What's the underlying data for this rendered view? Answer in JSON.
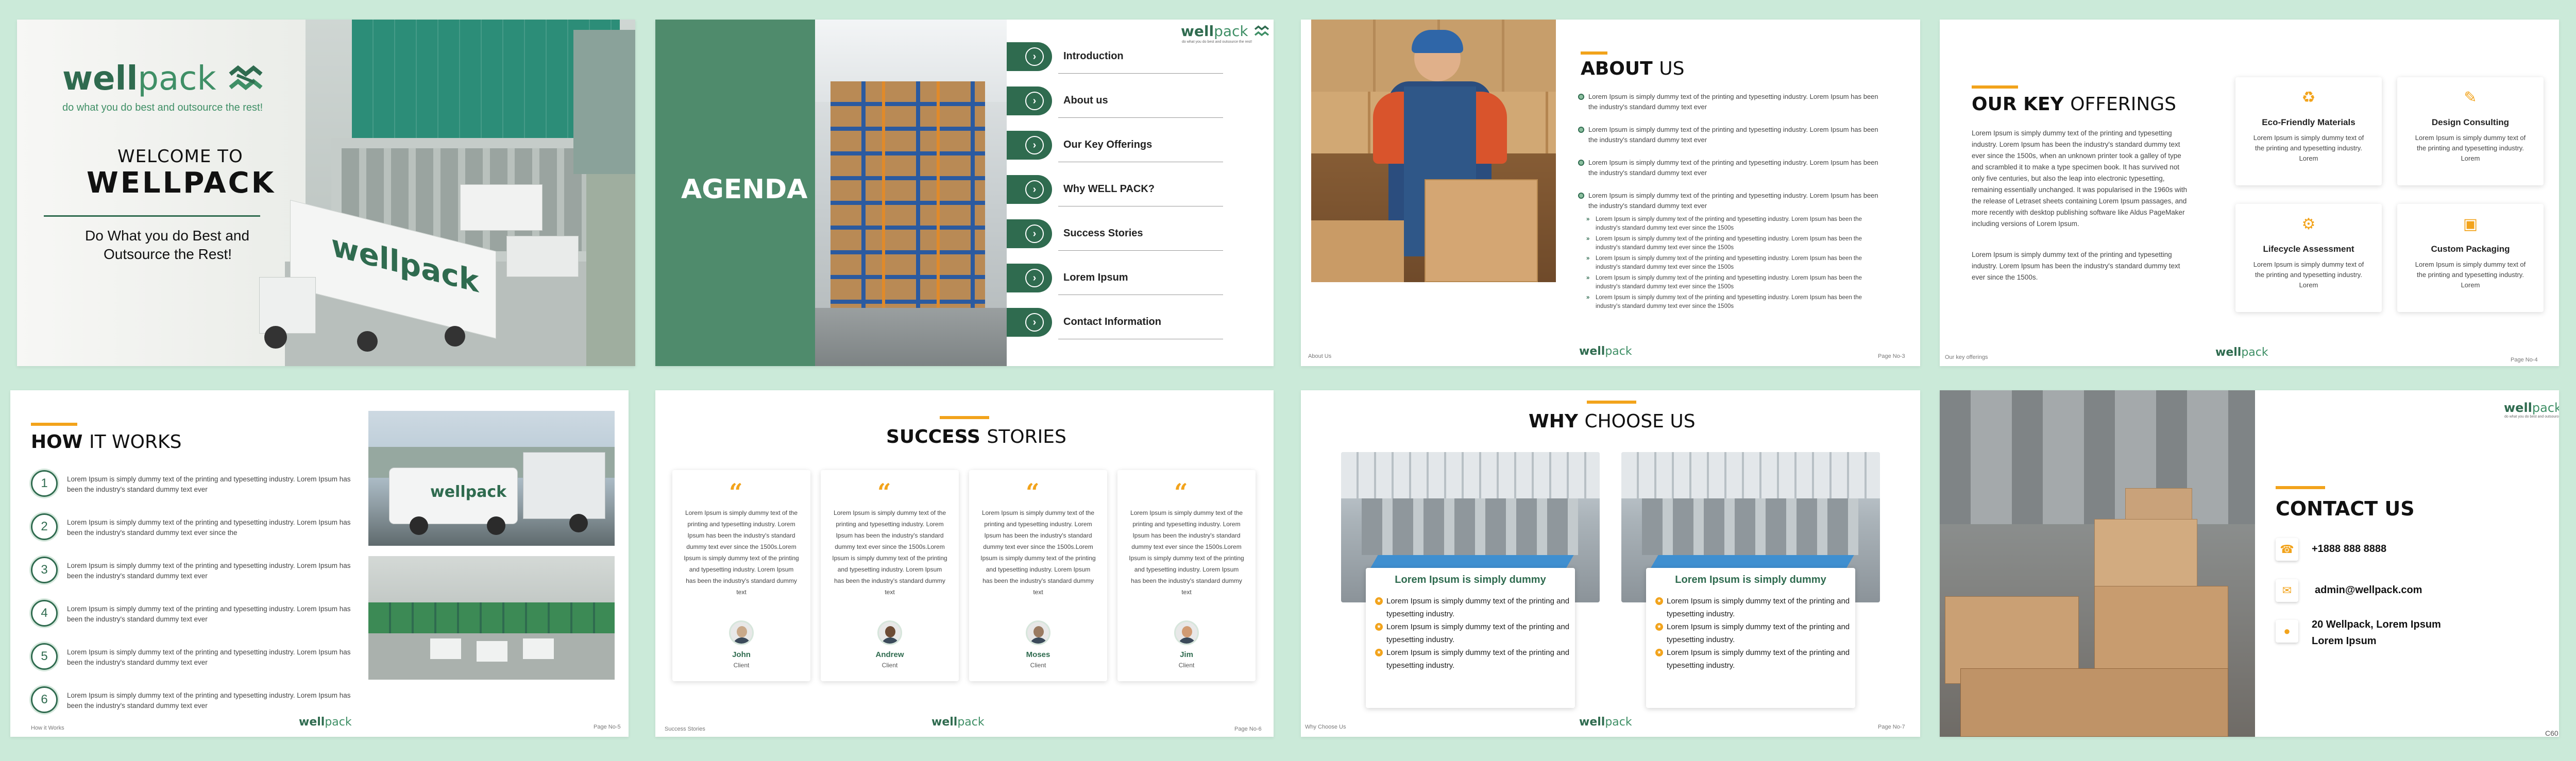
{
  "brand": {
    "name_bold": "well",
    "name_light": "pack",
    "tag": "do what you do best and outsource the rest!"
  },
  "s1": {
    "tagline": "do what you do best and outsource the rest!",
    "welcome": "WELCOME TO",
    "company": "WELLPACK",
    "sub1": "Do What you do Best and",
    "sub2": "Outsource the Rest!",
    "truck_text": "wellpack"
  },
  "s2": {
    "title": "AGENDA",
    "items": [
      "Introduction",
      "About us",
      "Our Key Offerings",
      "Why WELL PACK?",
      "Success Stories",
      "Lorem Ipsum",
      "Contact Information"
    ]
  },
  "s3": {
    "title_bold": "ABOUT",
    "title_light": "US",
    "bullets": [
      "Lorem Ipsum is simply dummy text of the printing and typesetting industry. Lorem Ipsum has been the industry's standard dummy text ever",
      "Lorem Ipsum is simply dummy text of the printing and typesetting industry. Lorem Ipsum has been the industry's standard dummy text ever",
      "Lorem Ipsum is simply dummy text of the printing and typesetting industry. Lorem Ipsum has been the industry's standard dummy text ever",
      "Lorem Ipsum is simply dummy text of the printing and typesetting industry. Lorem Ipsum has been the industry's standard dummy text ever"
    ],
    "sub": [
      "Lorem Ipsum is simply dummy text of the printing and typesetting industry. Lorem Ipsum has been the industry's standard dummy text ever since the 1500s",
      "Lorem Ipsum is simply dummy text of the printing and typesetting industry. Lorem Ipsum has been the industry's standard dummy text ever since the 1500s",
      "Lorem Ipsum is simply dummy text of the printing and typesetting industry. Lorem Ipsum has been the industry's standard dummy text ever since the 1500s",
      "Lorem Ipsum is simply dummy text of the printing and typesetting industry. Lorem Ipsum has been the industry's standard dummy text ever since the 1500s",
      "Lorem Ipsum is simply dummy text of the printing and typesetting industry. Lorem Ipsum has been the industry's standard dummy text ever since the 1500s"
    ],
    "footer": "About Us",
    "page": "Page No-3"
  },
  "s4": {
    "title_bold": "OUR KEY",
    "title_light": "OFFERINGS",
    "para1": "Lorem Ipsum is simply dummy text of the printing and typesetting industry. Lorem Ipsum has been the industry's standard dummy text ever since the 1500s, when an unknown printer took a galley of type and scrambled it to make a type specimen book. It has survived not only five centuries, but also the leap into electronic typesetting, remaining essentially unchanged. It was popularised in the 1960s with the release of Letraset sheets containing Lorem Ipsum passages, and more recently with desktop publishing software like Aldus PageMaker including versions of Lorem Ipsum.",
    "para2": "Lorem Ipsum is simply dummy text of the printing and typesetting industry. Lorem Ipsum has been the industry's standard dummy text ever since the 1500s.",
    "cards": [
      {
        "title": "Eco-Friendly Materials",
        "text": "Lorem Ipsum is simply dummy text of the printing and typesetting industry. Lorem"
      },
      {
        "title": "Design Consulting",
        "text": "Lorem Ipsum is simply dummy text of the printing and typesetting industry. Lorem"
      },
      {
        "title": "Lifecycle Assessment",
        "text": "Lorem Ipsum is simply dummy text of the printing and typesetting industry. Lorem"
      },
      {
        "title": "Custom Packaging",
        "text": "Lorem Ipsum is simply dummy text of the printing and typesetting industry. Lorem"
      }
    ],
    "footer": "Our key offerings",
    "page": "Page No-4"
  },
  "s5": {
    "title_bold": "HOW",
    "title_light": "IT WORKS",
    "steps": [
      {
        "n": "1",
        "text": "Lorem Ipsum is simply dummy text of the printing and typesetting industry. Lorem Ipsum has been the industry's standard dummy text ever"
      },
      {
        "n": "2",
        "text": "Lorem Ipsum is simply dummy text of the printing and typesetting industry. Lorem Ipsum has been the industry's standard dummy text ever since the"
      },
      {
        "n": "3",
        "text": "Lorem Ipsum is simply dummy text of the printing and typesetting industry. Lorem Ipsum has been the industry's standard dummy text ever"
      },
      {
        "n": "4",
        "text": "Lorem Ipsum is simply dummy text of the printing and typesetting industry. Lorem Ipsum has been the industry's standard dummy text ever"
      },
      {
        "n": "5",
        "text": "Lorem Ipsum is simply dummy text of the printing and typesetting industry. Lorem Ipsum has been the industry's standard dummy text ever"
      },
      {
        "n": "6",
        "text": "Lorem Ipsum is simply dummy text of the printing and typesetting industry. Lorem Ipsum has been the industry's standard dummy text ever"
      }
    ],
    "footer": "How it Works",
    "page": "Page No-5"
  },
  "s6": {
    "title_bold": "SUCCESS",
    "title_light": "STORIES",
    "cards": [
      {
        "name": "John",
        "role": "Client",
        "text": "Lorem Ipsum is simply dummy text of the printing and typesetting industry. Lorem Ipsum has been the industry's standard dummy text ever since the 1500s.Lorem Ipsum is simply dummy text of the printing and typesetting industry. Lorem Ipsum has been the industry's standard dummy text"
      },
      {
        "name": "Andrew",
        "role": "Client",
        "text": "Lorem Ipsum is simply dummy text of the printing and typesetting industry. Lorem Ipsum has been the industry's standard dummy text ever since the 1500s.Lorem Ipsum is simply dummy text of the printing and typesetting industry. Lorem Ipsum has been the industry's standard dummy text"
      },
      {
        "name": "Moses",
        "role": "Client",
        "text": "Lorem Ipsum is simply dummy text of the printing and typesetting industry. Lorem Ipsum has been the industry's standard dummy text ever since the 1500s.Lorem Ipsum is simply dummy text of the printing and typesetting industry. Lorem Ipsum has been the industry's standard dummy text"
      },
      {
        "name": "Jim",
        "role": "Client",
        "text": "Lorem Ipsum is simply dummy text of the printing and typesetting industry. Lorem Ipsum has been the industry's standard dummy text ever since the 1500s.Lorem Ipsum is simply dummy text of the printing and typesetting industry. Lorem Ipsum has been the industry's standard dummy text"
      }
    ],
    "footer": "Success Stories",
    "page": "Page No-6"
  },
  "s7": {
    "title_bold": "WHY",
    "title_light": "CHOOSE US",
    "cards": [
      {
        "heading": "Lorem Ipsum is simply dummy",
        "items": [
          "Lorem Ipsum is simply dummy text of the printing and typesetting industry.",
          "Lorem Ipsum is simply dummy text of the printing and typesetting industry.",
          "Lorem Ipsum is simply dummy text of the printing and typesetting industry."
        ]
      },
      {
        "heading": "Lorem Ipsum is simply dummy",
        "items": [
          "Lorem Ipsum is simply dummy text of the printing and typesetting industry.",
          "Lorem Ipsum is simply dummy text of the printing and typesetting industry.",
          "Lorem Ipsum is simply dummy text of the printing and typesetting industry."
        ]
      }
    ],
    "footer": "Why Choose Us",
    "page": "Page No-7"
  },
  "s8": {
    "title": "CONTACT US",
    "phone": "+1888 888 8888",
    "email": "admin@wellpack.com",
    "address1": "20 Wellpack, Lorem Ipsum",
    "address2": "Lorem Ipsum"
  },
  "corner": "C60",
  "colors": {
    "green": "#2f6b4f",
    "accent": "#f2a31b",
    "bg": "#cbead9"
  }
}
